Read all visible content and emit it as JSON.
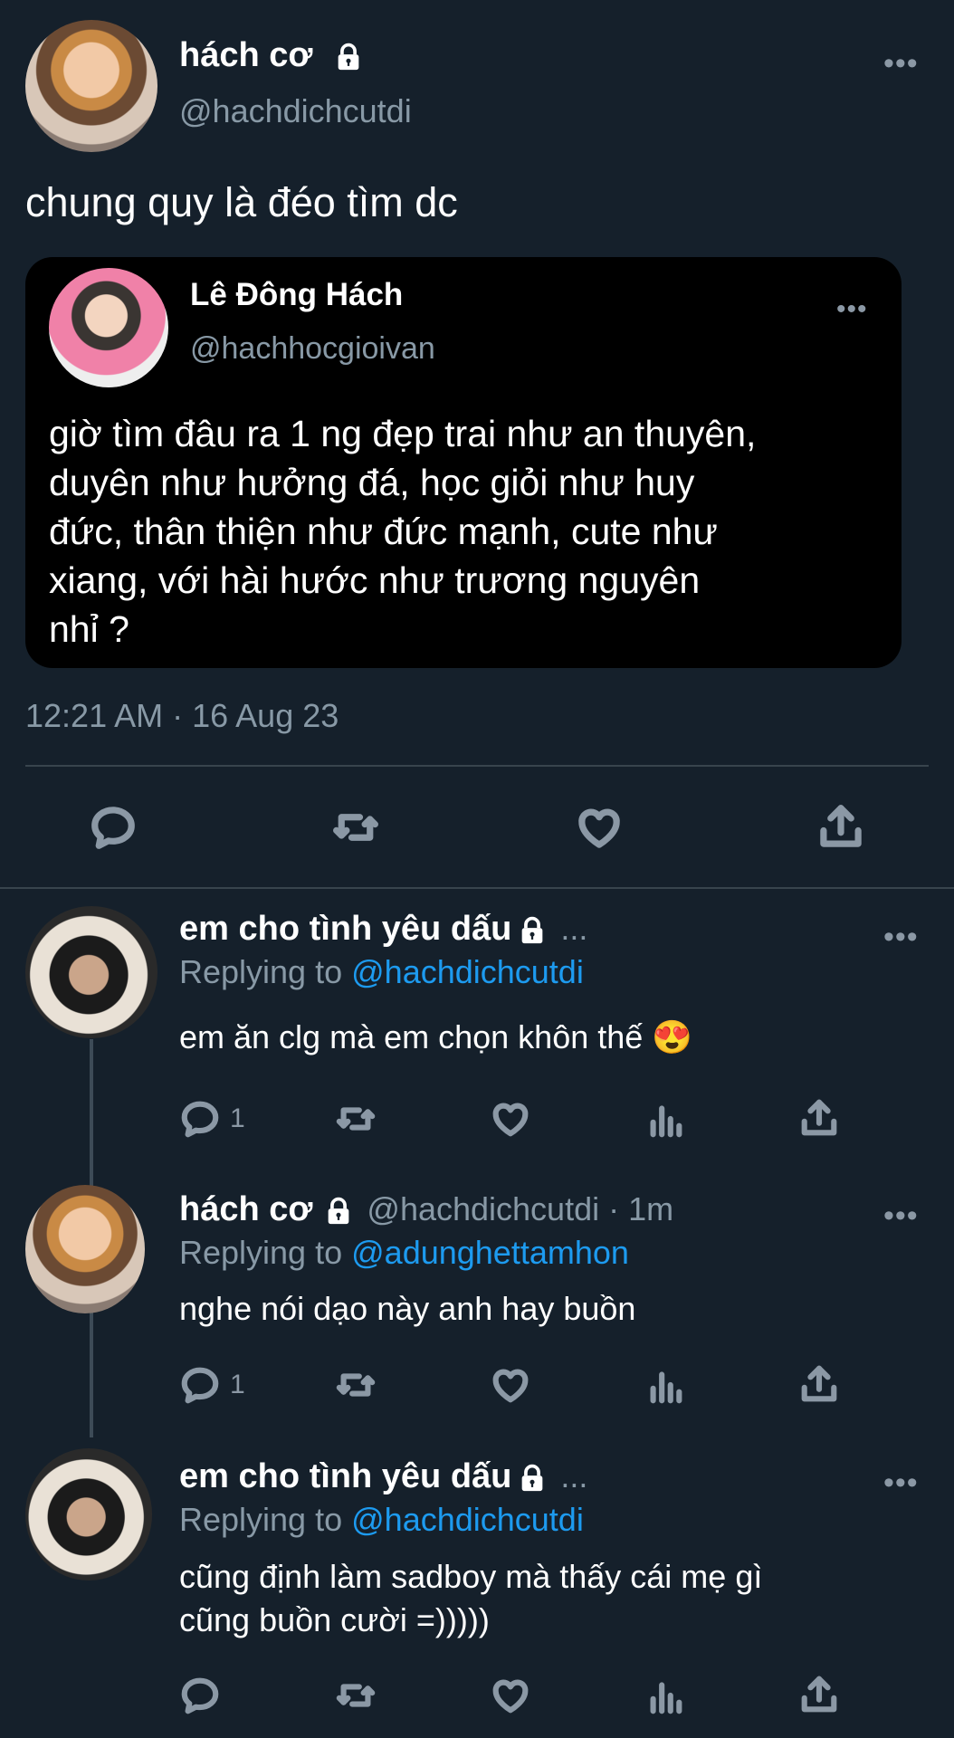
{
  "main_tweet": {
    "author_name": "hách cơ",
    "author_handle": "@hachdichcutdi",
    "text": "chung quy là đéo tìm dc",
    "timestamp": "12:21 AM · 16 Aug 23",
    "more_label": "•••",
    "quoted": {
      "author_name": "Lê Đông Hách",
      "author_handle": "@hachhocgioivan",
      "text_lines": [
        "giờ tìm đâu ra 1 ng đẹp trai như an thuyên,",
        "duyên như hưởng đá, học giỏi như huy",
        "đức, thân thiện như đức mạnh, cute như",
        "xiang, với hài hước như trương nguyên",
        "nhỉ ?"
      ],
      "more_label": "•••"
    },
    "actions": [
      "reply-icon",
      "retweet-icon",
      "like-icon",
      "share-icon"
    ]
  },
  "replies": [
    {
      "author_name": "em cho tình yêu dấu",
      "name_suffix": "...",
      "replying_prefix": "Replying to",
      "replying_to": "@hachdichcutdi",
      "text_lines": [
        "em ăn clg mà em chọn khôn thế 😍"
      ],
      "reply_count": "1",
      "more_label": "•••"
    },
    {
      "author_name": "hách cơ",
      "author_meta": "@hachdichcutdi · 1m",
      "replying_prefix": "Replying to",
      "replying_to": "@adunghettamhon",
      "text_lines": [
        "nghe nói dạo này anh hay buồn"
      ],
      "reply_count": "1",
      "more_label": "•••"
    },
    {
      "author_name": "em cho tình yêu dấu",
      "name_suffix": "...",
      "replying_prefix": "Replying to",
      "replying_to": "@hachdichcutdi",
      "text_lines": [
        "cũng định làm sadboy mà thấy cái mẹ gì",
        "cũng buồn cười =)))))"
      ],
      "reply_count": "",
      "more_label": "•••"
    }
  ],
  "colors": {
    "background": "#15202b",
    "quote_background": "#000000",
    "muted": "#8899a6",
    "link": "#1d9bf0"
  }
}
